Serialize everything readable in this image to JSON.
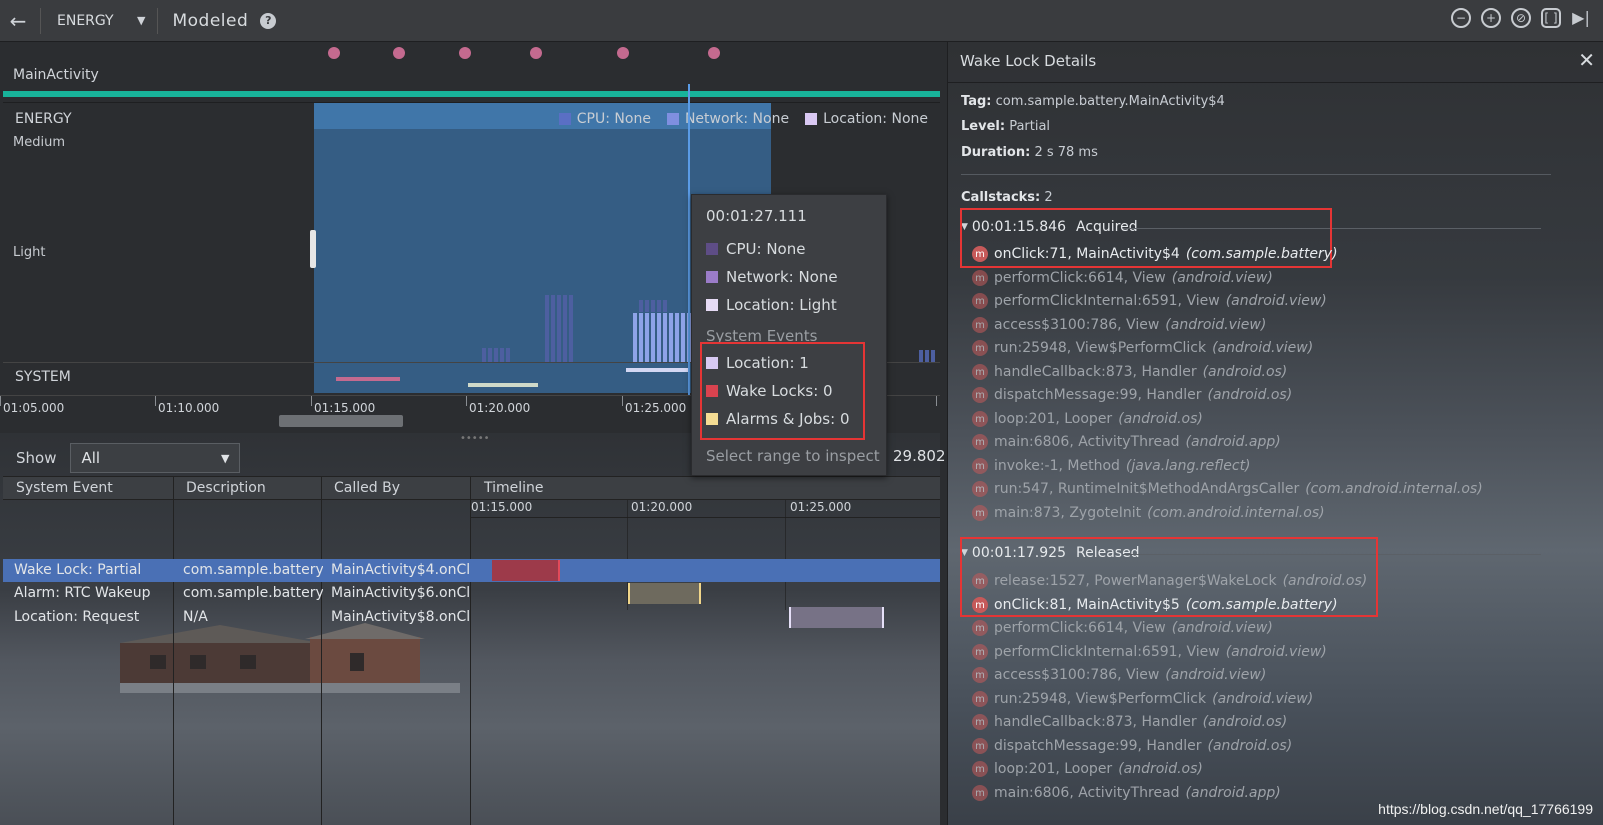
{
  "topbar": {
    "device": "ENERGY",
    "mode": "Modeled",
    "help": "?"
  },
  "timeline": {
    "activity": "MainActivity",
    "energy_label": "ENERGY",
    "axis_medium": "Medium",
    "axis_light": "Light",
    "system_label": "SYSTEM",
    "legend": [
      {
        "label": "CPU: None",
        "color": "#5a6fc4"
      },
      {
        "label": "Network: None",
        "color": "#7f8fe0"
      },
      {
        "label": "Location: None",
        "color": "#d9c8f2"
      }
    ],
    "ticks": [
      "01:05.000",
      "01:10.000",
      "01:15.000",
      "01:20.000",
      "01:25.000"
    ]
  },
  "tooltip": {
    "time": "00:01:27.111",
    "rows": [
      {
        "label": "CPU: None",
        "color": "#5e4d86"
      },
      {
        "label": "Network: None",
        "color": "#9b7cc9"
      },
      {
        "label": "Location: Light",
        "color": "#e6dbf5"
      }
    ],
    "section": "System Events",
    "events": [
      {
        "label": "Location: 1",
        "color": "#d7c9f2"
      },
      {
        "label": "Wake Locks: 0",
        "color": "#d9434f"
      },
      {
        "label": "Alarms & Jobs: 0",
        "color": "#f4dc93"
      }
    ],
    "footer": "Select range to inspect"
  },
  "filter": {
    "show_label": "Show",
    "selected": "All",
    "end_time": "29.802"
  },
  "table": {
    "headers": [
      "System Event",
      "Description",
      "Called By",
      "Timeline"
    ],
    "timeline_ticks": [
      "01:15.000",
      "01:20.000",
      "01:25.000"
    ],
    "rows": [
      {
        "event": "Wake Lock: Partial",
        "description": "com.sample.battery....",
        "called_by": "MainActivity$4.onCl..."
      },
      {
        "event": "Alarm: RTC Wakeup",
        "description": "com.sample.battery",
        "called_by": "MainActivity$6.onCl..."
      },
      {
        "event": "Location: Request",
        "description": "N/A",
        "called_by": "MainActivity$8.onCl..."
      }
    ]
  },
  "details": {
    "title": "Wake Lock Details",
    "tag_label": "Tag:",
    "tag": "com.sample.battery.MainActivity$4",
    "level_label": "Level:",
    "level": "Partial",
    "duration_label": "Duration:",
    "duration": "2 s 78 ms",
    "callstacks_label": "Callstacks:",
    "callstacks_count": "2",
    "acquired": {
      "time": "00:01:15.846",
      "state": "Acquired",
      "frames": [
        {
          "method": "onClick:71, MainActivity$4",
          "pkg": "(com.sample.battery)"
        },
        {
          "method": "performClick:6614, View",
          "pkg": "(android.view)"
        },
        {
          "method": "performClickInternal:6591, View",
          "pkg": "(android.view)"
        },
        {
          "method": "access$3100:786, View",
          "pkg": "(android.view)"
        },
        {
          "method": "run:25948, View$PerformClick",
          "pkg": "(android.view)"
        },
        {
          "method": "handleCallback:873, Handler",
          "pkg": "(android.os)"
        },
        {
          "method": "dispatchMessage:99, Handler",
          "pkg": "(android.os)"
        },
        {
          "method": "loop:201, Looper",
          "pkg": "(android.os)"
        },
        {
          "method": "main:6806, ActivityThread",
          "pkg": "(android.app)"
        },
        {
          "method": "invoke:-1, Method",
          "pkg": "(java.lang.reflect)"
        },
        {
          "method": "run:547, RuntimeInit$MethodAndArgsCaller",
          "pkg": "(com.android.internal.os)"
        },
        {
          "method": "main:873, ZygoteInit",
          "pkg": "(com.android.internal.os)"
        }
      ]
    },
    "released": {
      "time": "00:01:17.925",
      "state": "Released",
      "frames": [
        {
          "method": "release:1527, PowerManager$WakeLock",
          "pkg": "(android.os)"
        },
        {
          "method": "onClick:81, MainActivity$5",
          "pkg": "(com.sample.battery)"
        },
        {
          "method": "performClick:6614, View",
          "pkg": "(android.view)"
        },
        {
          "method": "performClickInternal:6591, View",
          "pkg": "(android.view)"
        },
        {
          "method": "access$3100:786, View",
          "pkg": "(android.view)"
        },
        {
          "method": "run:25948, View$PerformClick",
          "pkg": "(android.view)"
        },
        {
          "method": "handleCallback:873, Handler",
          "pkg": "(android.os)"
        },
        {
          "method": "dispatchMessage:99, Handler",
          "pkg": "(android.os)"
        },
        {
          "method": "loop:201, Looper",
          "pkg": "(android.os)"
        },
        {
          "method": "main:6806, ActivityThread",
          "pkg": "(android.app)"
        }
      ]
    },
    "frame_icon": "m"
  },
  "watermark": "https://blog.csdn.net/qq_17766199"
}
